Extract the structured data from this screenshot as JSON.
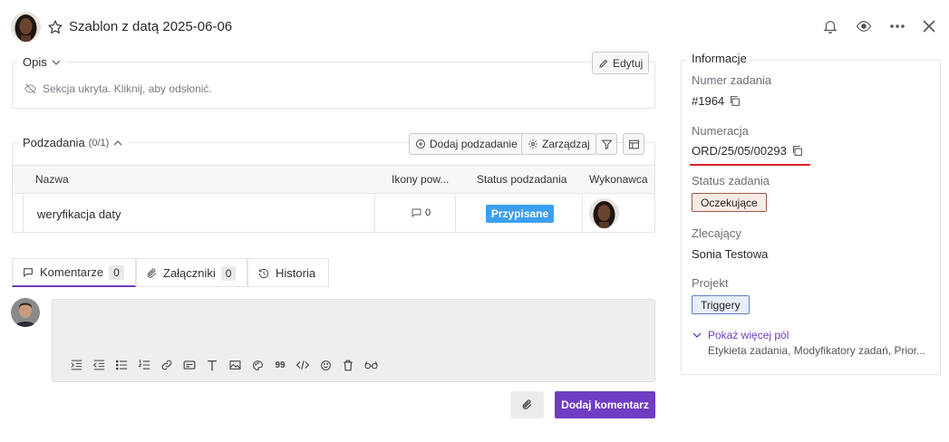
{
  "header": {
    "title": "Szablon z datą 2025-06-06"
  },
  "description": {
    "label": "Opis",
    "edit_label": "Edytuj",
    "hidden_text": "Sekcja ukryta. Kliknij, aby odsłonić."
  },
  "subtasks": {
    "label": "Podzadania",
    "count": "(0/1)",
    "add_label": "Dodaj podzadanie",
    "manage_label": "Zarządzaj",
    "columns": [
      "Nazwa",
      "Ikony pow...",
      "Status podzadania",
      "Wykonawca"
    ],
    "rows": [
      {
        "name": "weryfikacja daty",
        "comments": "0",
        "status": "Przypisane"
      }
    ]
  },
  "tabs": [
    {
      "label": "Komentarze",
      "count": "0"
    },
    {
      "label": "Załączniki",
      "count": "0"
    },
    {
      "label": "Historia"
    }
  ],
  "comment": {
    "submit_label": "Dodaj komentarz",
    "toolbar_quote_label": "99"
  },
  "sidebar": {
    "title": "Informacje",
    "task_number_label": "Numer zadania",
    "task_number": "#1964",
    "numbering_label": "Numeracja",
    "numbering": "ORD/25/05/00293",
    "status_label": "Status zadania",
    "status": "Oczekujące",
    "requester_label": "Zlecający",
    "requester": "Sonia Testowa",
    "project_label": "Projekt",
    "project": "Triggery",
    "more_fields_label": "Pokaż więcej pól",
    "more_fields_list": "Etykieta zadania, Modyfikatory zadań, Prior..."
  },
  "colors": {
    "accent": "#6f3cc3",
    "status_blue": "#3b9ff0",
    "red_underline": "#e0202a"
  }
}
